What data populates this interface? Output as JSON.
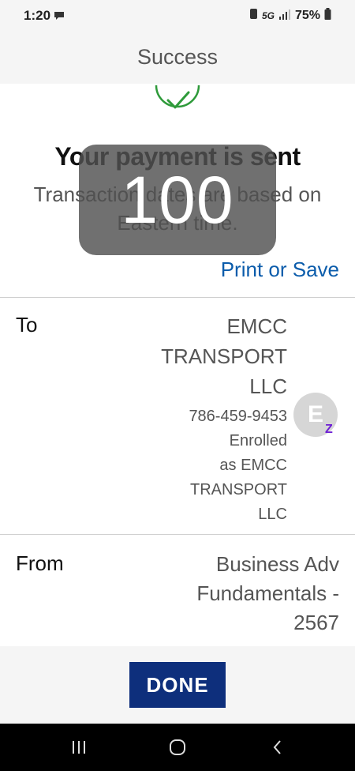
{
  "status_bar": {
    "time": "1:20",
    "network": "5G",
    "battery": "75%",
    "icons": [
      "chat-icon",
      "sim-icon",
      "signal-icon",
      "battery-icon"
    ]
  },
  "header": {
    "title": "Success"
  },
  "confirmation": {
    "icon": "check-circle-icon",
    "headline": "Your payment is sent",
    "subtext": "Transaction dates are based on Eastern time.",
    "amount": "100",
    "print_link": "Print or Save"
  },
  "to_section": {
    "label": "To",
    "name_lines": [
      "EMCC",
      "TRANSPORT",
      "LLC"
    ],
    "phone": "786-459-9453",
    "enrolled_lines": [
      "Enrolled",
      "as EMCC",
      "TRANSPORT",
      "LLC"
    ],
    "avatar_letter": "E",
    "badge": "Z"
  },
  "from_section": {
    "label": "From",
    "account_lines": [
      "Business Adv",
      "Fundamentals -",
      "2567"
    ]
  },
  "done_button": "DONE",
  "nav_bar": {
    "icons": [
      "recent-apps-icon",
      "home-icon",
      "back-icon"
    ]
  },
  "colors": {
    "accent_link": "#0b5cab",
    "success_green": "#2e9a3a",
    "done_button_bg": "#0e2f7c",
    "zelle_purple": "#6d1ed4"
  }
}
